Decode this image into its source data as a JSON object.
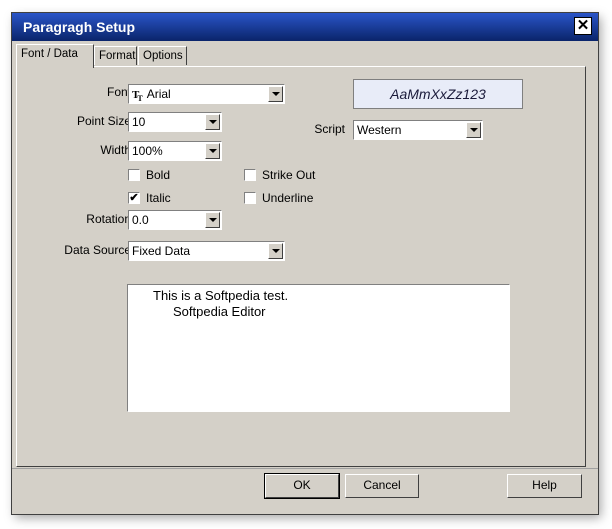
{
  "window": {
    "title": "Paragragh Setup",
    "close_label": "✕"
  },
  "tabs": [
    {
      "label": "Font / Data",
      "active": true
    },
    {
      "label": "Format",
      "active": false
    },
    {
      "label": "Options",
      "active": false
    }
  ],
  "font": {
    "label": "Font",
    "value": "Arial",
    "icon": "truetype-icon"
  },
  "preview": {
    "text": "AaMmXxZz123"
  },
  "point_size": {
    "label": "Point Size",
    "value": "10"
  },
  "script": {
    "label": "Script",
    "value": "Western"
  },
  "width": {
    "label": "Width",
    "value": "100%"
  },
  "styles": {
    "bold": {
      "label": "Bold",
      "checked": false
    },
    "strike_out": {
      "label": "Strike Out",
      "checked": false
    },
    "italic": {
      "label": "Italic",
      "checked": true
    },
    "underline": {
      "label": "Underline",
      "checked": false
    }
  },
  "rotation": {
    "label": "Rotation",
    "value": "0.0"
  },
  "data_source": {
    "label": "Data Source",
    "value": "Fixed Data"
  },
  "text_area": {
    "line1": "This is a Softpedia test.",
    "line2": "Softpedia Editor"
  },
  "buttons": {
    "ok": "OK",
    "cancel": "Cancel",
    "help": "Help"
  },
  "check_mark": "✔"
}
